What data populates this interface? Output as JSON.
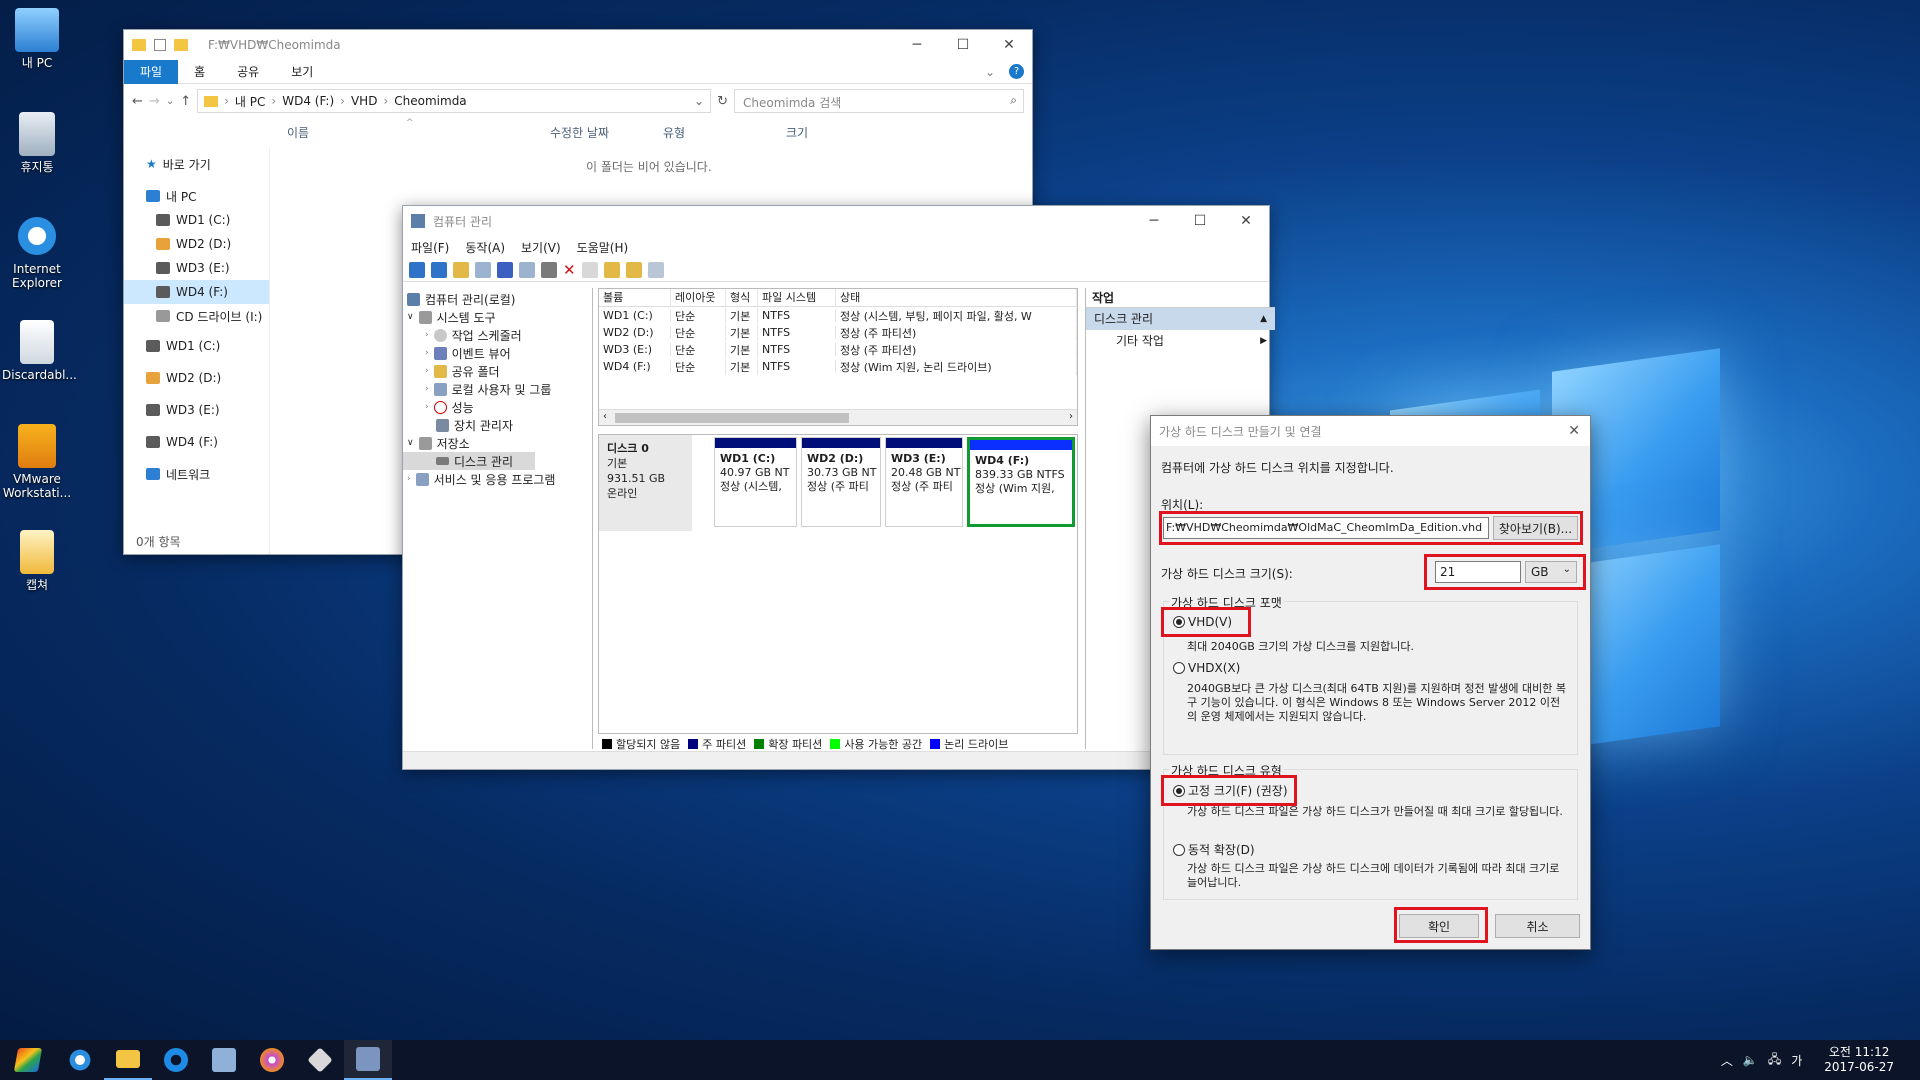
{
  "desktop": {
    "icons": [
      {
        "label": "내 PC"
      },
      {
        "label": "휴지통"
      },
      {
        "label": "Internet Explorer"
      },
      {
        "label": "Discardabl..."
      },
      {
        "label": "VMware Workstati..."
      },
      {
        "label": "캡쳐"
      }
    ]
  },
  "explorer": {
    "title": "F:₩VHD₩Cheomimda",
    "tabs": [
      "파일",
      "홈",
      "공유",
      "보기"
    ],
    "breadcrumb": [
      "내 PC",
      "WD4 (F:)",
      "VHD",
      "Cheomimda"
    ],
    "search_placeholder": "Cheomimda 검색",
    "nav": [
      "바로 가기",
      "내 PC",
      "WD1 (C:)",
      "WD2 (D:)",
      "WD3 (E:)",
      "WD4 (F:)",
      "CD 드라이브 (I:)",
      "WD1 (C:)",
      "WD2 (D:)",
      "WD3 (E:)",
      "WD4 (F:)",
      "네트워크"
    ],
    "columns": [
      "이름",
      "수정한 날짜",
      "유형",
      "크기"
    ],
    "empty_message": "이 폴더는 비어 있습니다.",
    "status": "0개 항목"
  },
  "compmgmt": {
    "title": "컴퓨터 관리",
    "menu": [
      "파일(F)",
      "동작(A)",
      "보기(V)",
      "도움말(H)"
    ],
    "tree": [
      {
        "label": "컴퓨터 관리(로컬)"
      },
      {
        "label": "시스템 도구"
      },
      {
        "label": "작업 스케줄러"
      },
      {
        "label": "이벤트 뷰어"
      },
      {
        "label": "공유 폴더"
      },
      {
        "label": "로컬 사용자 및 그룹"
      },
      {
        "label": "성능"
      },
      {
        "label": "장치 관리자"
      },
      {
        "label": "저장소"
      },
      {
        "label": "디스크 관리"
      },
      {
        "label": "서비스 및 응용 프로그램"
      }
    ],
    "volume_columns": [
      "볼륨",
      "레이아웃",
      "형식",
      "파일 시스템",
      "상태"
    ],
    "volumes": [
      [
        "WD1 (C:)",
        "단순",
        "기본",
        "NTFS",
        "정상 (시스템, 부팅, 페이지 파일, 활성, W"
      ],
      [
        "WD2 (D:)",
        "단순",
        "기본",
        "NTFS",
        "정상 (주 파티션)"
      ],
      [
        "WD3 (E:)",
        "단순",
        "기본",
        "NTFS",
        "정상 (주 파티션)"
      ],
      [
        "WD4 (F:)",
        "단순",
        "기본",
        "NTFS",
        "정상 (Wim 지원, 논리 드라이브)"
      ]
    ],
    "disk": {
      "name": "디스크 0",
      "type": "기본",
      "size": "931.51 GB",
      "state": "온라인"
    },
    "partitions": [
      {
        "name": "WD1  (C:)",
        "size": "40.97 GB NT",
        "status": "정상 (시스템,"
      },
      {
        "name": "WD2  (D:)",
        "size": "30.73 GB NT",
        "status": "정상 (주 파티"
      },
      {
        "name": "WD3  (E:)",
        "size": "20.48 GB NT",
        "status": "정상 (주 파티"
      },
      {
        "name": "WD4  (F:)",
        "size": "839.33 GB NTFS",
        "status": "정상 (Wim 지원,"
      }
    ],
    "legend": [
      {
        "label": "할당되지 않음",
        "color": "#000000"
      },
      {
        "label": "주 파티션",
        "color": "#00007f"
      },
      {
        "label": "확장 파티션",
        "color": "#008000"
      },
      {
        "label": "사용 가능한 공간",
        "color": "#00ff00"
      },
      {
        "label": "논리 드라이브",
        "color": "#0000ff"
      }
    ],
    "actions_header": "작업",
    "actions_section": "디스크 관리",
    "actions_item": "기타 작업"
  },
  "dialog": {
    "title": "가상 하드 디스크 만들기 및 연결",
    "intro": "컴퓨터에 가상 하드 디스크 위치를 지정합니다.",
    "location_label": "위치(L):",
    "location_value": "F:₩VHD₩Cheomimda₩OldMaC_CheomImDa_Edition.vhd",
    "browse_label": "찾아보기(B)...",
    "size_label": "가상 하드 디스크 크기(S):",
    "size_value": "21",
    "size_unit": "GB",
    "format_group": "가상 하드 디스크 포맷",
    "vhd_label": "VHD(V)",
    "vhd_desc": "최대 2040GB 크기의 가상 디스크를 지원합니다.",
    "vhdx_label": "VHDX(X)",
    "vhdx_desc": "2040GB보다 큰 가상 디스크(최대 64TB 지원)를 지원하며 정전 발생에 대비한 복구 기능이 있습니다. 이 형식은 Windows 8 또는 Windows Server 2012 이전의 운영 체제에서는 지원되지 않습니다.",
    "type_group": "가상 하드 디스크 유형",
    "fixed_label": "고정 크기(F) (권장)",
    "fixed_desc": "가상 하드 디스크 파일은 가상 하드 디스크가 만들어질 때 최대 크기로 할당됩니다.",
    "dynamic_label": "동적 확장(D)",
    "dynamic_desc": "가상 하드 디스크 파일은 가상 하드 디스크에 데이터가 기록됨에 따라 최대 크기로 늘어납니다.",
    "ok_label": "확인",
    "cancel_label": "취소"
  },
  "taskbar": {
    "ime": "가",
    "time": "오전 11:12",
    "date": "2017-06-27"
  }
}
